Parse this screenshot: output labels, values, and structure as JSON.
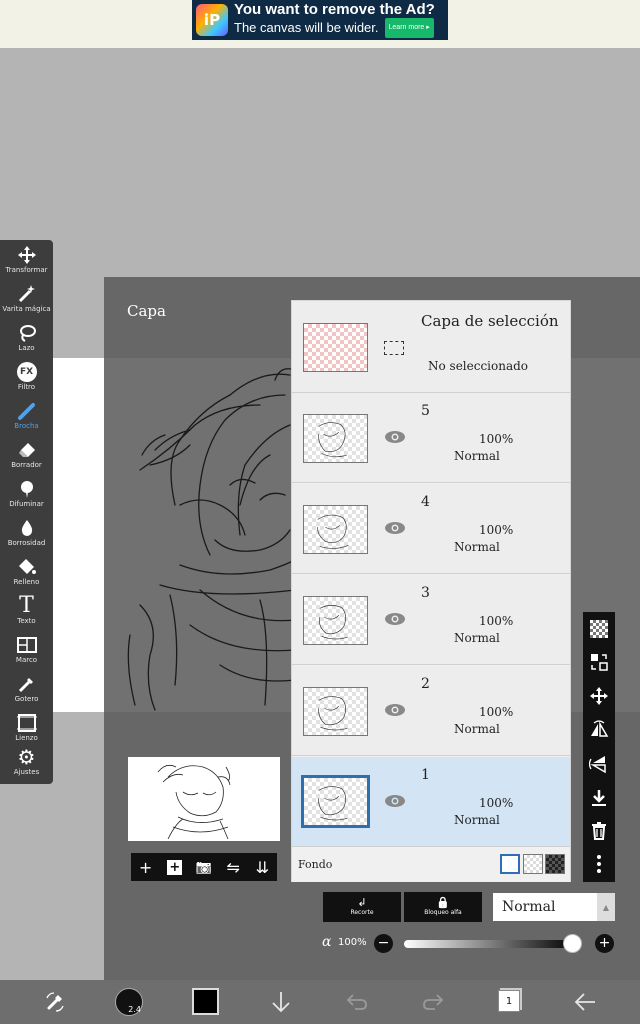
{
  "ad": {
    "logo": "iP",
    "title": "You want to remove the Ad?",
    "subtitle": "The canvas will be wider.",
    "cta": "Learn more ▸"
  },
  "toolbar": {
    "items": [
      {
        "label": "Transformar",
        "icon": "move-icon"
      },
      {
        "label": "Varita mágica",
        "icon": "magic-wand-icon"
      },
      {
        "label": "Lazo",
        "icon": "lasso-icon"
      },
      {
        "label": "Filtro",
        "icon": "fx-icon",
        "glyph": "FX"
      },
      {
        "label": "Brocha",
        "icon": "brush-icon",
        "active": true
      },
      {
        "label": "Borrador",
        "icon": "eraser-icon"
      },
      {
        "label": "Difuminar",
        "icon": "smudge-icon"
      },
      {
        "label": "Borrosidad",
        "icon": "blur-drop-icon"
      },
      {
        "label": "Relleno",
        "icon": "fill-bucket-icon"
      },
      {
        "label": "Texto",
        "icon": "text-icon",
        "glyph": "T"
      },
      {
        "label": "Marco",
        "icon": "frame-divider-icon"
      },
      {
        "label": "Gotero",
        "icon": "eyedropper-icon"
      },
      {
        "label": "Lienzo",
        "icon": "canvas-icon"
      },
      {
        "label": "Ajustes",
        "icon": "gear-icon",
        "glyph": "⚙"
      }
    ]
  },
  "panel": {
    "title": "Capa"
  },
  "selection_layer": {
    "title": "Capa de selección",
    "status": "No seleccionado"
  },
  "layers": [
    {
      "number": "5",
      "opacity": "100%",
      "mode": "Normal",
      "selected": false
    },
    {
      "number": "4",
      "opacity": "100%",
      "mode": "Normal",
      "selected": false
    },
    {
      "number": "3",
      "opacity": "100%",
      "mode": "Normal",
      "selected": false
    },
    {
      "number": "2",
      "opacity": "100%",
      "mode": "Normal",
      "selected": false
    },
    {
      "number": "1",
      "opacity": "100%",
      "mode": "Normal",
      "selected": true
    }
  ],
  "background": {
    "label": "Fondo"
  },
  "layer_actions": {
    "add": "+",
    "add_copy": "+",
    "camera": "📷",
    "flip": "⇋",
    "merge": "⇊"
  },
  "buttons": {
    "recorte_label": "Recorte",
    "recorte_icon": "↲",
    "bloqueo_label": "Bloqueo alfa",
    "bloqueo_icon": "🔒"
  },
  "blend_mode": {
    "value": "Normal",
    "arrow": "▲"
  },
  "alpha": {
    "symbol": "α",
    "value": "100%",
    "minus": "−",
    "plus": "+",
    "level": 1.0
  },
  "right_toolbar": {
    "items": [
      "checker-icon",
      "swap-icon",
      "move-icon",
      "flip-horizontal-icon",
      "flip-vertical-icon",
      "merge-down-icon",
      "trash-icon",
      "more-icon"
    ]
  },
  "bottom_bar": {
    "brush_size": "2.4",
    "layers_count": "1",
    "color": "#000000"
  }
}
